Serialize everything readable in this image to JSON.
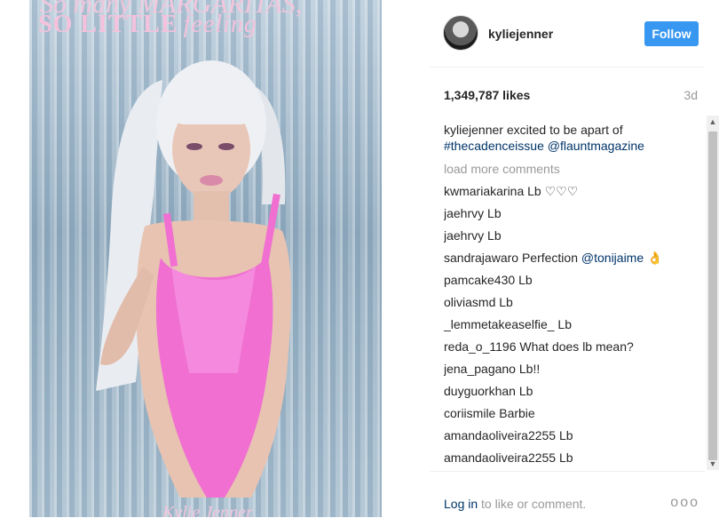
{
  "photo": {
    "headline": "So many MARGARITAS,",
    "subline_main": "SO LITTLE",
    "subline_script": "feeling",
    "footer_text": "Kylie Jenner"
  },
  "header": {
    "username": "kyliejenner",
    "follow_label": "Follow",
    "avatar_icon": "profile-avatar"
  },
  "stats": {
    "likes": "1,349,787 likes",
    "time": "3d"
  },
  "caption": {
    "user": "kyliejenner",
    "text": "excited to be apart of",
    "hashtag": "#thecadenceissue",
    "mention": "@flauntmagazine"
  },
  "load_more": "load more comments",
  "comments": [
    {
      "user": "kwmariakarina",
      "text": "Lb ♡♡♡",
      "mention": ""
    },
    {
      "user": "jaehrvy",
      "text": "Lb",
      "mention": ""
    },
    {
      "user": "jaehrvy",
      "text": "Lb",
      "mention": ""
    },
    {
      "user": "sandrajawaro",
      "text": "Perfection",
      "mention": "@tonijaime 👌"
    },
    {
      "user": "pamcake430",
      "text": "Lb",
      "mention": ""
    },
    {
      "user": "oliviasmd",
      "text": "Lb",
      "mention": ""
    },
    {
      "user": "_lemmetakeaselfie_",
      "text": "Lb",
      "mention": ""
    },
    {
      "user": "reda_o_1196",
      "text": "What does lb mean?",
      "mention": ""
    },
    {
      "user": "jena_pagano",
      "text": "Lb!!",
      "mention": ""
    },
    {
      "user": "duyguorkhan",
      "text": "Lb",
      "mention": ""
    },
    {
      "user": "coriismile",
      "text": "Barbie",
      "mention": ""
    },
    {
      "user": "amandaoliveira2255",
      "text": "Lb",
      "mention": ""
    },
    {
      "user": "amandaoliveira2255",
      "text": "Lb",
      "mention": ""
    }
  ],
  "footer": {
    "login_link": "Log in",
    "login_rest": " to like or comment.",
    "more_label": "ooo"
  },
  "colors": {
    "accent": "#3897f0",
    "link": "#003569",
    "muted": "#999999"
  }
}
